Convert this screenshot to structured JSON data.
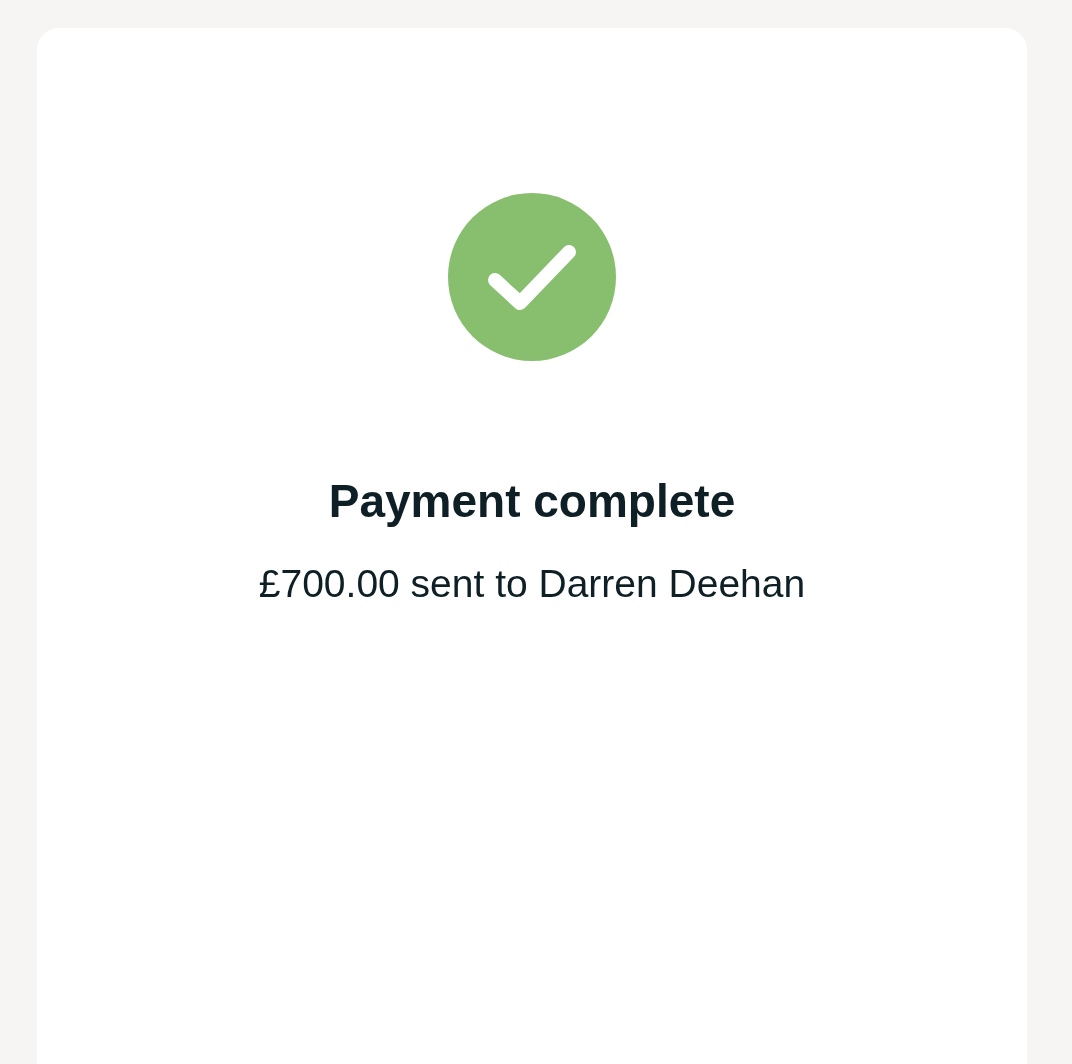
{
  "status": {
    "kind": "success"
  },
  "title": "Payment complete",
  "message": "£700.00 sent to Darren Deehan"
}
